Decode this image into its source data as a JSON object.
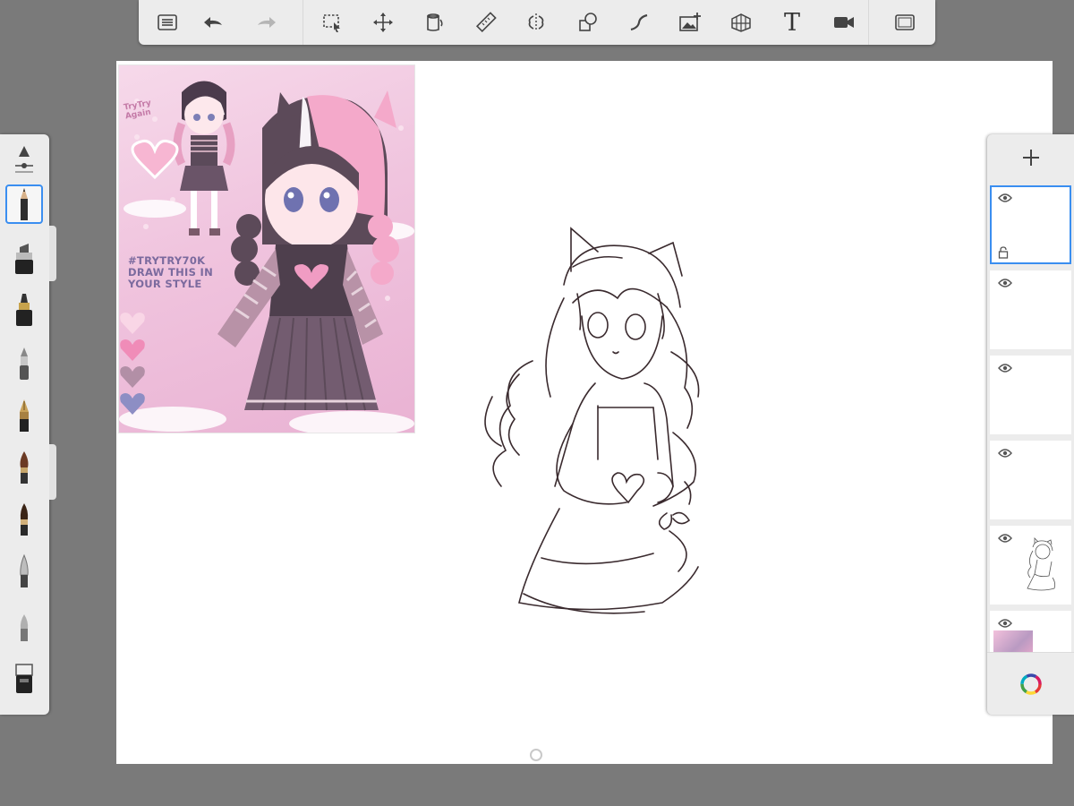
{
  "toolbar": {
    "buttons": [
      {
        "name": "gallery-icon"
      },
      {
        "name": "undo-icon"
      },
      {
        "name": "redo-icon"
      },
      {
        "name": "selection-icon"
      },
      {
        "name": "transform-icon"
      },
      {
        "name": "fill-icon"
      },
      {
        "name": "ruler-icon"
      },
      {
        "name": "symmetry-icon"
      },
      {
        "name": "shape-icon"
      },
      {
        "name": "stroke-icon"
      },
      {
        "name": "image-import-icon"
      },
      {
        "name": "perspective-icon"
      },
      {
        "name": "text-tool-icon",
        "label": "T"
      },
      {
        "name": "timelapse-icon"
      },
      {
        "name": "fullscreen-icon"
      }
    ]
  },
  "reference": {
    "watermark": "TryTry Again",
    "lines": [
      "#TRYTRY70K",
      "DRAW THIS IN",
      "YOUR STYLE"
    ],
    "swatches": [
      "#f9d6e6",
      "#f08cb8",
      "#b28fa6",
      "#8d8ec4"
    ]
  },
  "brushes": {
    "selected_index": 1,
    "items": [
      "brush-size-icon",
      "pencil-icon",
      "marker-icon",
      "felt-pen-icon",
      "airbrush-icon",
      "ink-pen-icon",
      "paintbrush-icon",
      "watercolor-brush-icon",
      "smudge-icon",
      "blur-icon",
      "eraser-icon"
    ]
  },
  "layers": {
    "selected_index": 0,
    "count": 6
  },
  "colors": {
    "accent": "#3a8ef0",
    "panel": "#ececec",
    "sketch": "#3a2a2e"
  }
}
